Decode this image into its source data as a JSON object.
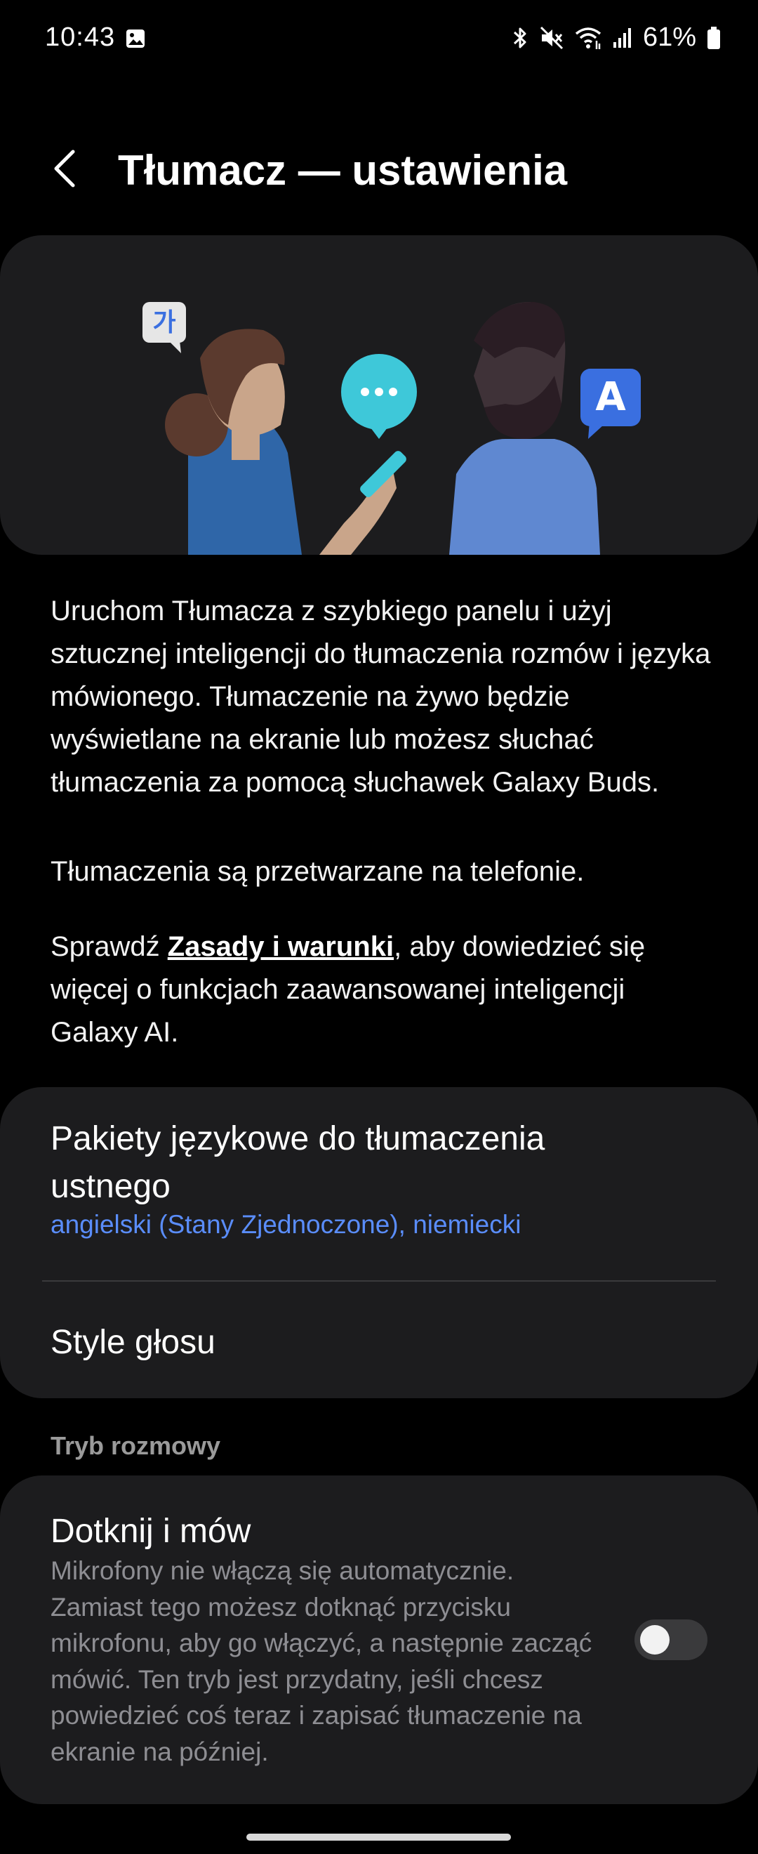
{
  "status_bar": {
    "time": "10:43",
    "battery": "61%",
    "icons": [
      "gallery-icon",
      "bluetooth-icon",
      "mute-icon",
      "wifi-icon",
      "signal-icon",
      "battery-icon"
    ]
  },
  "header": {
    "title": "Tłumacz — ustawienia",
    "back_icon": "back-arrow-icon"
  },
  "hero": {
    "bubble_left": "가",
    "bubble_right": "A",
    "colors": {
      "bubble_mid": "#3ec8d9",
      "bubble_right": "#3a6fe0",
      "shirt_left": "#2f66a8",
      "shirt_right": "#5f88d1"
    }
  },
  "description": {
    "paragraph1": "Uruchom Tłumacza z szybkiego panelu i użyj sztucznej inteligencji do tłumaczenia rozmów i języka mówionego. Tłumaczenie na żywo będzie wyświetlane na ekranie lub możesz słuchać tłumaczenia za pomocą słuchawek Galaxy Buds.",
    "paragraph2": "Tłumaczenia są przetwarzane na telefonie.",
    "paragraph3_prefix": "Sprawdź ",
    "paragraph3_link": "Zasady i warunki",
    "paragraph3_suffix": ", aby dowiedzieć się więcej o funkcjach zaawansowanej inteligencji Galaxy AI."
  },
  "settings": {
    "language_packs_title": "Pakiety językowe do tłumaczenia ustnego",
    "language_packs_value": "angielski (Stany Zjednoczone), niemiecki",
    "voice_style_title": "Style głosu",
    "section_conversation": "Tryb rozmowy",
    "tap_to_talk_title": "Dotknij i mów",
    "tap_to_talk_desc": "Mikrofony nie włączą się automatycznie. Zamiast tego możesz dotknąć przycisku mikrofonu, aby go włączyć, a następnie zacząć mówić. Ten tryb jest przydatny, jeśli chcesz powiedzieć coś teraz i zapisać tłumaczenie na ekranie na później.",
    "tap_to_talk_enabled": false
  },
  "colors": {
    "accent": "#5a8dfb",
    "card": "#1c1c1e",
    "background": "#000000"
  }
}
